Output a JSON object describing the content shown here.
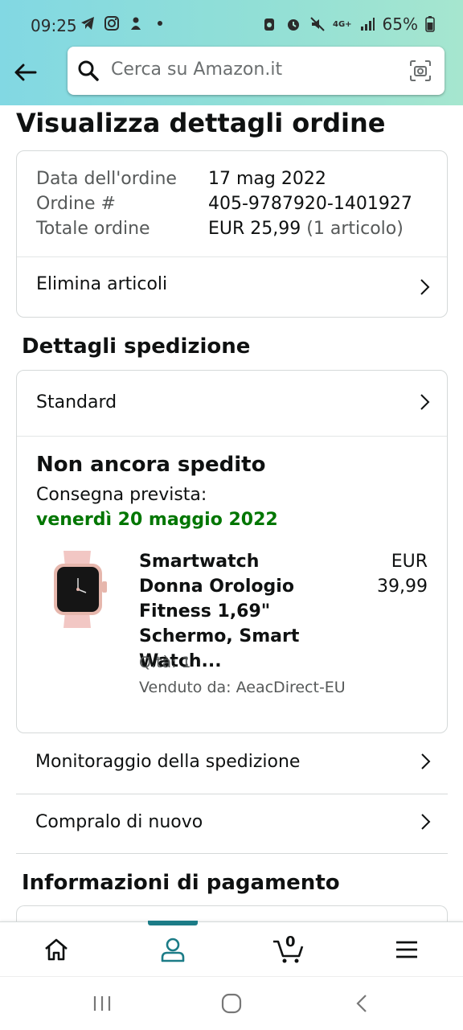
{
  "status_bar": {
    "time": "09:25",
    "network": "4G+",
    "battery": "65%"
  },
  "search": {
    "placeholder": "Cerca su Amazon.it"
  },
  "page": {
    "title": "Visualizza dettagli ordine"
  },
  "order_summary": {
    "rows": [
      {
        "label": "Data dell'ordine",
        "value": "17 mag 2022"
      },
      {
        "label": "Ordine #",
        "value": "405-9787920-1401927"
      },
      {
        "label": "Totale ordine",
        "value_main": "EUR 25,99",
        "value_extra": " (1 articolo)"
      }
    ],
    "action": "Elimina articoli"
  },
  "shipping": {
    "heading": "Dettagli spedizione",
    "method": "Standard",
    "status": "Non ancora spedito",
    "delivery_label": "Consegna prevista:",
    "delivery_date": "venerdì 20 maggio 2022",
    "product": {
      "name": "Smartwatch Donna Orologio Fitness 1,69\" Schermo, Smart Watch...",
      "price_currency": "EUR",
      "price_value": "39,99",
      "qty": "Q.tà: 1",
      "seller": "Venduto da: AeacDirect-EU"
    }
  },
  "actions": {
    "track": "Monitoraggio della spedizione",
    "buy_again": "Compralo di nuovo"
  },
  "payment": {
    "heading": "Informazioni di pagamento"
  },
  "bottom_nav": {
    "cart_count": "0",
    "active": "account",
    "accent": "#1c7c87"
  },
  "colors": {
    "header_gradient_start": "#82d8e3",
    "header_gradient_end": "#a6e6cf",
    "delivery_green": "#007600"
  }
}
